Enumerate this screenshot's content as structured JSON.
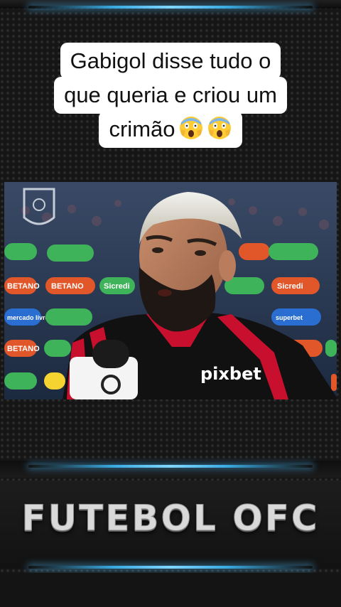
{
  "caption": {
    "lines": [
      "Gabigol disse tudo o",
      "que queria e criou um",
      "crimão"
    ],
    "emoji_icons": [
      "face-screaming-in-fear-icon",
      "face-screaming-in-fear-icon"
    ]
  },
  "video": {
    "sponsor_jersey": "pixbet",
    "ad_boards": [
      "BETANO",
      "Sicredi",
      "mercado livre",
      "BETANO",
      "Sicredi",
      "BETANO",
      "superbet"
    ]
  },
  "brand": {
    "title": "FUTEBOL OFC"
  },
  "colors": {
    "accent_glow": "#39a9e0",
    "caption_bg": "#ffffff",
    "jersey_red": "#c8102e",
    "jersey_black": "#111111"
  }
}
